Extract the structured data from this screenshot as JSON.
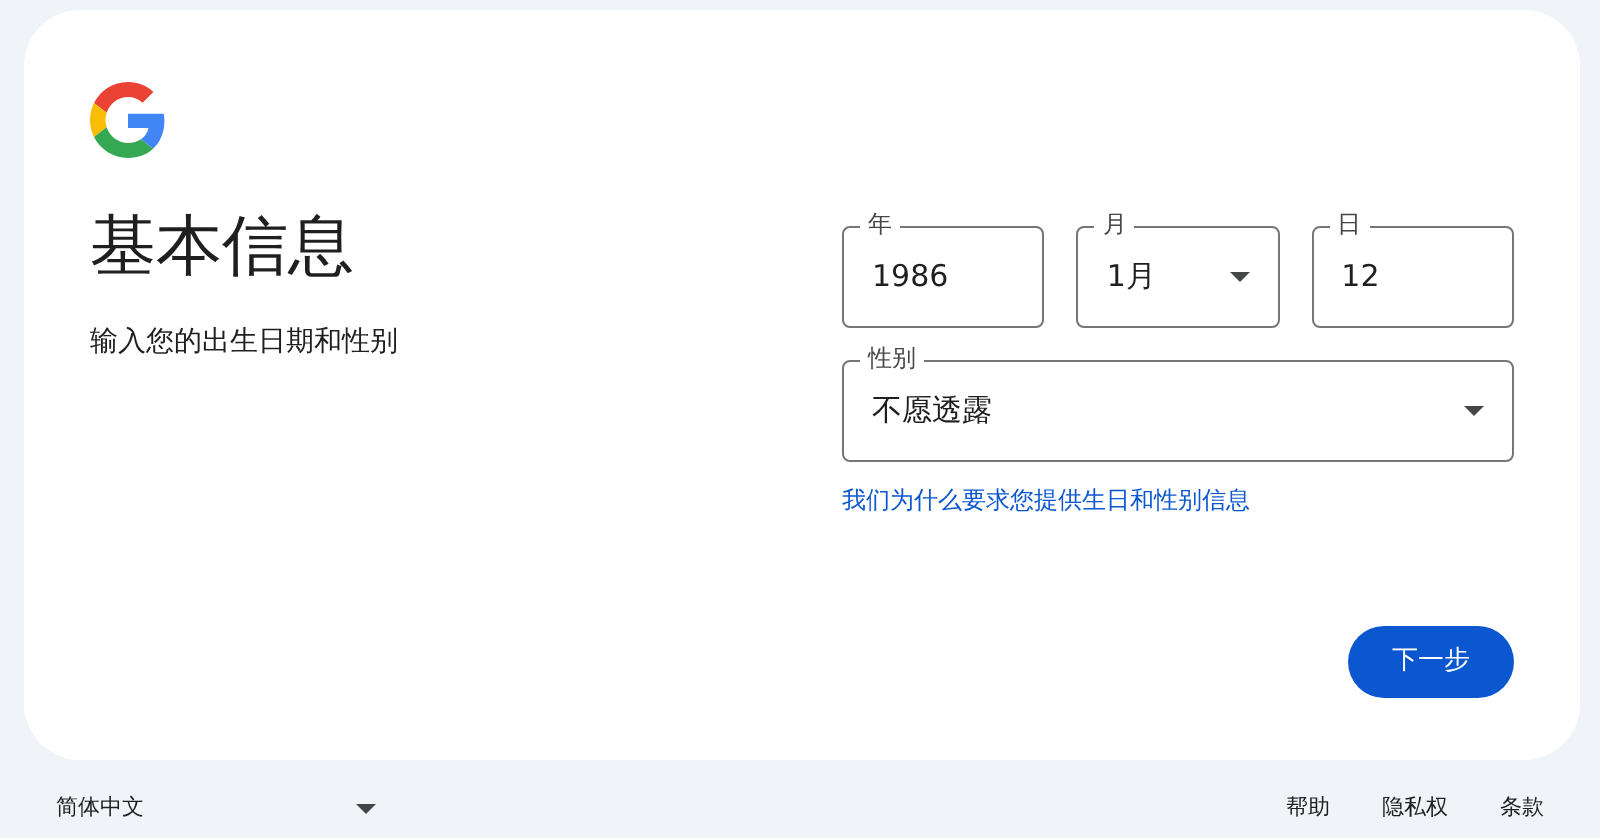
{
  "title": "基本信息",
  "subtitle": "输入您的出生日期和性别",
  "date_fields": [
    {
      "label": "年",
      "value": "1986",
      "kind": "text"
    },
    {
      "label": "月",
      "value": "1月",
      "kind": "select"
    },
    {
      "label": "日",
      "value": "12",
      "kind": "text"
    }
  ],
  "gender_field": {
    "label": "性别",
    "value": "不愿透露",
    "kind": "select"
  },
  "help_link": "我们为什么要求您提供生日和性别信息",
  "next_button": "下一步",
  "footer": {
    "language": "简体中文",
    "links": [
      "帮助",
      "隐私权",
      "条款"
    ]
  }
}
